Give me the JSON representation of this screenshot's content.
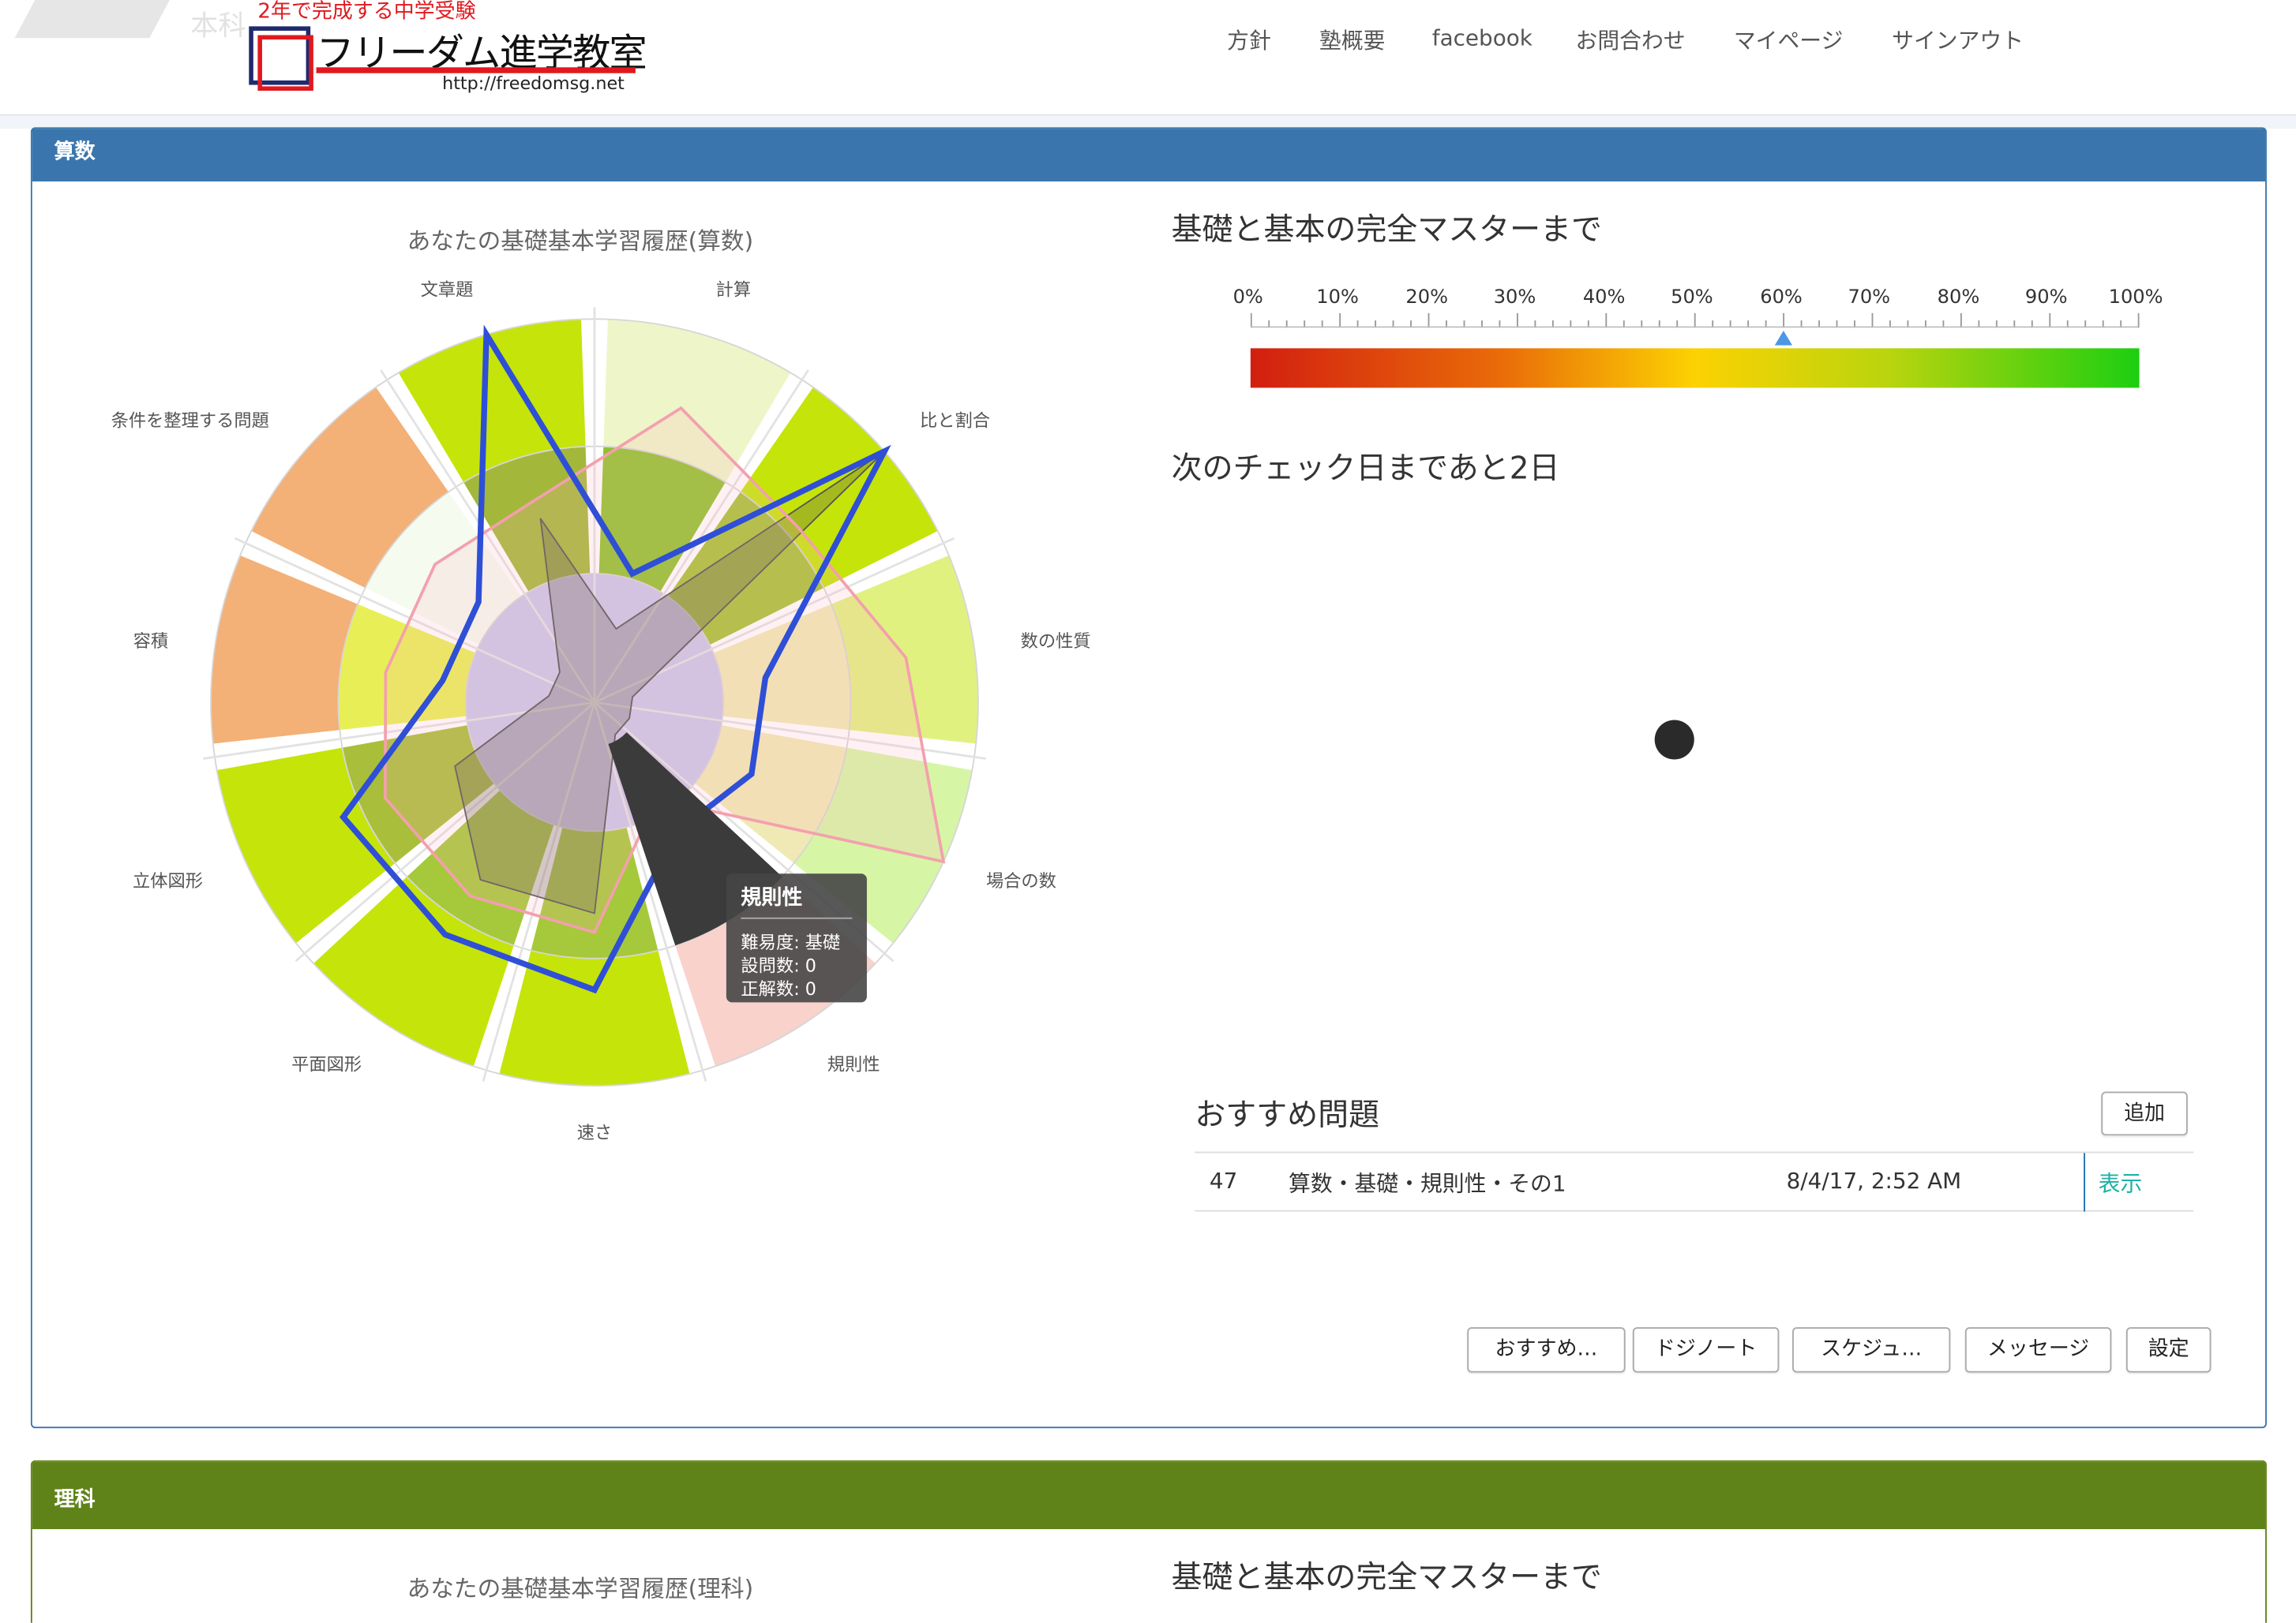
{
  "header": {
    "ghost_text": "本科",
    "logo_tagline": "2年で完成する中学受験",
    "logo_name": "フリーダム進学教室",
    "logo_url": "http://freedomsg.net",
    "nav": [
      "方針",
      "塾概要",
      "facebook",
      "お問合わせ",
      "マイページ",
      "サインアウト"
    ]
  },
  "math": {
    "panel_title": "算数",
    "chart_title": "あなたの基礎基本学習履歴(算数)",
    "mastery_title": "基礎と基本の完全マスターまで",
    "progress_ticks": [
      "0%",
      "10%",
      "20%",
      "30%",
      "40%",
      "50%",
      "60%",
      "70%",
      "80%",
      "90%",
      "100%"
    ],
    "progress_value": 60,
    "next_check": "次のチェック日まであと2日",
    "tooltip": {
      "title": "規則性",
      "line1": "難易度: 基礎",
      "line2": "設問数: 0",
      "line3": "正解数: 0"
    },
    "recommend": {
      "title": "おすすめ問題",
      "add_label": "追加",
      "row": {
        "num": "47",
        "name": "算数・基礎・規則性・その1",
        "date": "8/4/17, 2:52 AM",
        "action": "表示"
      }
    },
    "buttons": [
      "おすすめ…",
      "ドジノート",
      "スケジュ…",
      "メッセージ",
      "設定"
    ]
  },
  "science": {
    "panel_title": "理科",
    "chart_title": "あなたの基礎基本学習履歴(理科)",
    "mastery_title": "基礎と基本の完全マスターまで"
  },
  "chart_data": {
    "type": "radar",
    "title": "あなたの基礎基本学習履歴(算数)",
    "categories": [
      "計算",
      "比と割合",
      "数の性質",
      "場合の数",
      "規則性",
      "速さ",
      "平面図形",
      "立体図形",
      "容積",
      "条件を整理する問題",
      "文章題"
    ],
    "outer_colors": [
      "#eef5c8",
      "#c5e40a",
      "#e1f180",
      "#d6f6a5",
      "#f9d2cc",
      "#c5e40a",
      "#c5e40a",
      "#c5e40a",
      "#f3b077",
      "#f3b077",
      "#c5e40a"
    ],
    "mid_colors": [
      "#8fc22e",
      "#a7c335",
      "#f0eab5",
      "#f0e9b5",
      "#cfe0f0",
      "#a5c93a",
      "#a5c93a",
      "#a9be3a",
      "#e8ef56",
      "#f5fbef",
      "#a3b83a"
    ],
    "series": [
      {
        "name": "blue",
        "values": [
          35,
          100,
          45,
          45,
          40,
          75,
          72,
          72,
          40,
          40,
          100
        ]
      },
      {
        "name": "pink",
        "values": [
          80,
          70,
          82,
          100,
          30,
          60,
          60,
          60,
          55,
          55,
          55
        ]
      },
      {
        "name": "gray",
        "values": [
          20,
          100,
          10,
          10,
          10,
          55,
          55,
          40,
          12,
          12,
          50
        ]
      }
    ]
  }
}
